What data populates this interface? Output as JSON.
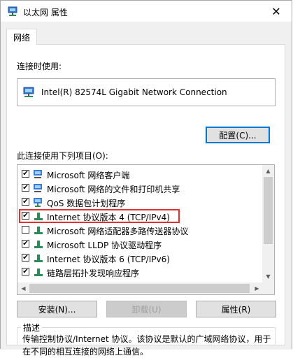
{
  "window": {
    "title": "以太网 属性"
  },
  "tabs": [
    {
      "label": "网络"
    }
  ],
  "connect_using": {
    "label": "连接时使用:",
    "adapter": "Intel(R) 82574L Gigabit Network Connection",
    "configure_button": "配置(C)..."
  },
  "items_section": {
    "label": "此连接使用下列项目(O):",
    "items": [
      {
        "label": "Microsoft 网络客户端",
        "checked": true
      },
      {
        "label": "Microsoft 网络的文件和打印机共享",
        "checked": true
      },
      {
        "label": "QoS 数据包计划程序",
        "checked": true
      },
      {
        "label": "Internet 协议版本 4 (TCP/IPv4)",
        "checked": true,
        "highlighted": true
      },
      {
        "label": "Microsoft 网络适配器多路传送器协议",
        "checked": false
      },
      {
        "label": "Microsoft LLDP 协议驱动程序",
        "checked": true
      },
      {
        "label": "Internet 协议版本 6 (TCP/IPv6)",
        "checked": true
      },
      {
        "label": "链路层拓扑发现响应程序",
        "checked": true
      }
    ]
  },
  "buttons": {
    "install": "安装(N)...",
    "uninstall": "卸载(U)",
    "properties": "属性(R)"
  },
  "description": {
    "title": "描述",
    "text": "传输控制协议/Internet 协议。该协议是默认的广域网络协议，用于在不同的相互连接的网络上通信。"
  },
  "colors": {
    "highlight_border": "#e03030",
    "accent": "#0078d7"
  }
}
